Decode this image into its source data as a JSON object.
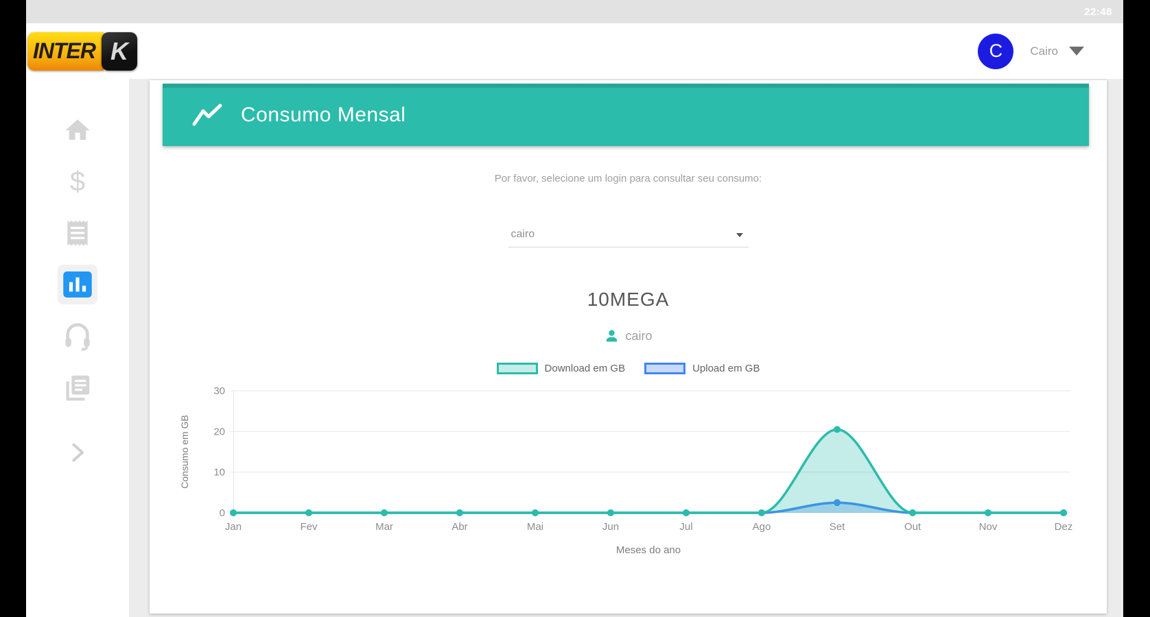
{
  "status_bar": {
    "time": "22:48"
  },
  "header": {
    "logo_text_1": "INTER",
    "logo_text_2": "K",
    "user_initial": "C",
    "user_name": "Cairo"
  },
  "sidebar": {
    "items": [
      {
        "id": "home",
        "icon": "home-icon",
        "active": false
      },
      {
        "id": "financial",
        "icon": "dollar-icon",
        "active": false
      },
      {
        "id": "invoices",
        "icon": "receipt-icon",
        "active": false
      },
      {
        "id": "consumption",
        "icon": "bar-chart-icon",
        "active": true
      },
      {
        "id": "support",
        "icon": "headset-icon",
        "active": false
      },
      {
        "id": "documents",
        "icon": "documents-icon",
        "active": false
      }
    ],
    "expand_icon": "chevron-right-icon",
    "active_color": "#2196f3",
    "inactive_color": "#d5d5d5"
  },
  "content": {
    "card_title": "Consumo Mensal",
    "card_title_icon": "trending-up-icon",
    "instruction": "Por favor, selecione um login para consultar seu consumo:",
    "login_select_value": "cairo",
    "plan_title": "10MEGA",
    "selected_login": "cairo",
    "accent_teal": "#2bbcab"
  },
  "chart_data": {
    "type": "area",
    "categories": [
      "Jan",
      "Fev",
      "Mar",
      "Abr",
      "Mai",
      "Jun",
      "Jul",
      "Ago",
      "Set",
      "Out",
      "Nov",
      "Dez"
    ],
    "series": [
      {
        "name": "Download em GB",
        "line_color": "#2bbcab",
        "fill_color": "rgba(43,188,171,0.28)",
        "values": [
          0,
          0,
          0,
          0,
          0,
          0,
          0,
          0,
          20.5,
          0,
          0,
          0
        ]
      },
      {
        "name": "Upload em GB",
        "line_color": "#4285f4",
        "fill_color": "rgba(66,133,244,0.30)",
        "values": [
          0,
          0,
          0,
          0,
          0,
          0,
          0,
          0,
          2.5,
          0,
          0,
          0
        ]
      }
    ],
    "xlabel": "Meses do ano",
    "ylabel": "Consumo em GB",
    "ylim": [
      0,
      30
    ],
    "yticks": [
      0,
      10,
      20,
      30
    ],
    "legend_position": "top",
    "grid": true
  }
}
